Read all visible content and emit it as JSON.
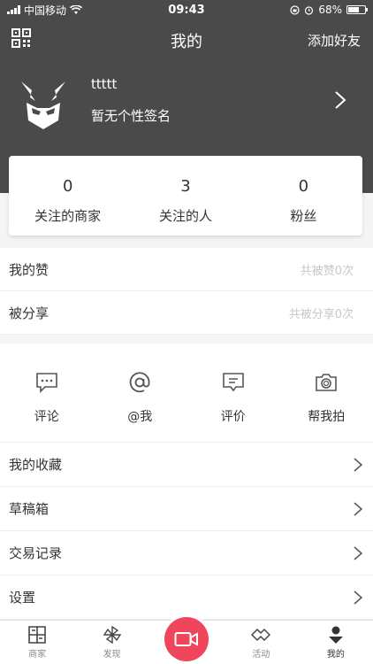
{
  "status_bar": {
    "carrier": "中国移动",
    "time": "09:43",
    "battery": "68%",
    "battery_level": 0.68
  },
  "nav": {
    "title": "我的",
    "add_friend": "添加好友"
  },
  "profile": {
    "username": "ttttt",
    "signature": "暂无个性签名"
  },
  "stats": [
    {
      "count": "0",
      "label": "关注的商家"
    },
    {
      "count": "3",
      "label": "关注的人"
    },
    {
      "count": "0",
      "label": "粉丝"
    }
  ],
  "likes": {
    "label": "我的赞",
    "summary": "共被赞0次"
  },
  "shares": {
    "label": "被分享",
    "summary": "共被分享0次"
  },
  "actions": [
    {
      "label": "评论",
      "icon": "chat-bubble-icon"
    },
    {
      "label": "@我",
      "icon": "at-icon"
    },
    {
      "label": "评价",
      "icon": "review-icon"
    },
    {
      "label": "帮我拍",
      "icon": "camera-icon"
    }
  ],
  "menu": [
    {
      "label": "我的收藏"
    },
    {
      "label": "草稿箱"
    },
    {
      "label": "交易记录"
    },
    {
      "label": "设置"
    }
  ],
  "tabs": [
    {
      "label": "商家"
    },
    {
      "label": "发现"
    },
    {
      "label": ""
    },
    {
      "label": "活动"
    },
    {
      "label": "我的"
    }
  ],
  "colors": {
    "header_bg": "#4a4a4a",
    "accent": "#f0465c"
  }
}
